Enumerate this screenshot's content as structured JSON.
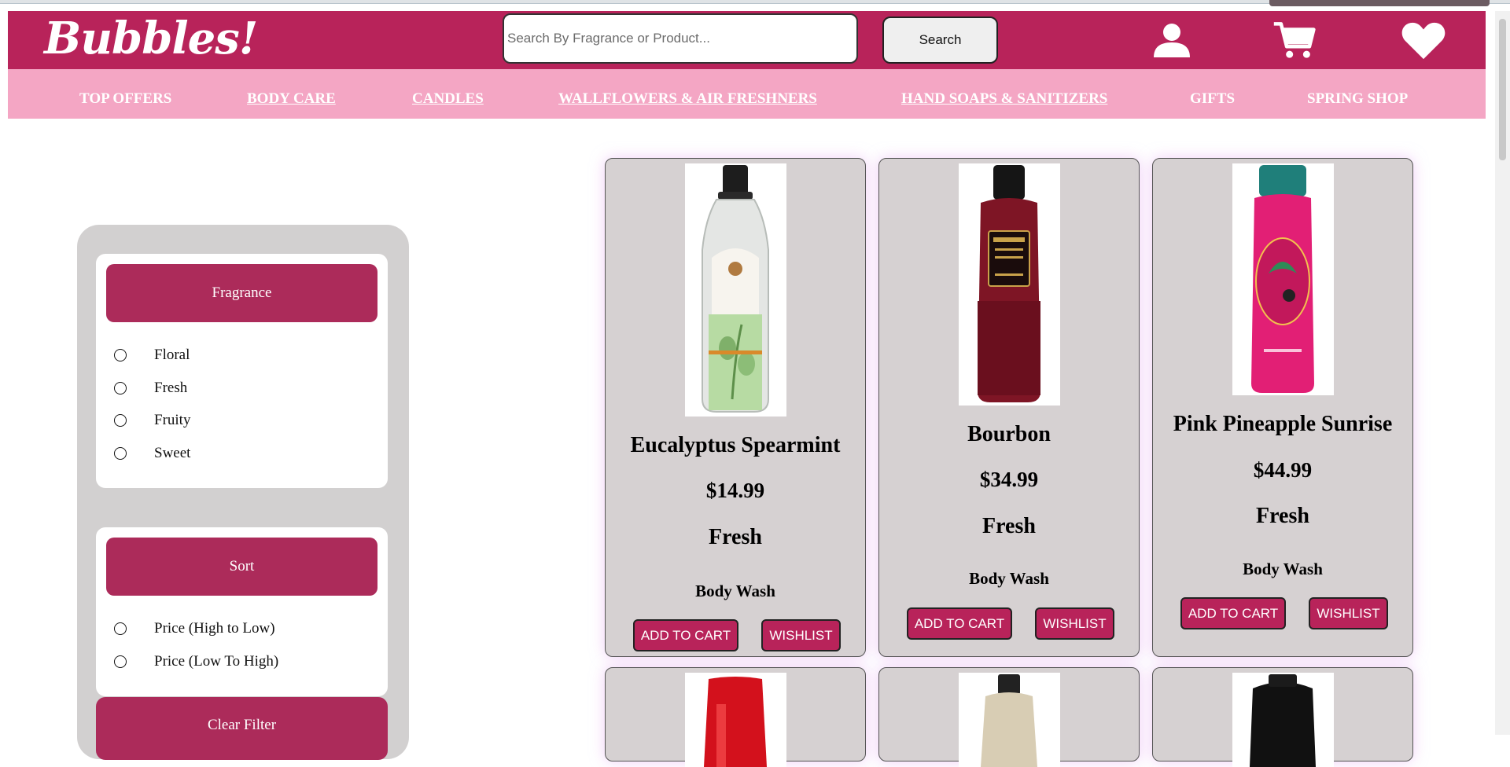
{
  "header": {
    "logo": "Bubbles!",
    "search": {
      "placeholder": "Search By Fragrance or Product...",
      "value": ""
    },
    "search_button": "Search",
    "icons": [
      "user-icon",
      "cart-icon",
      "heart-icon"
    ]
  },
  "nav": {
    "items": [
      {
        "label": "TOP OFFERS"
      },
      {
        "label": "BODY CARE"
      },
      {
        "label": "CANDLES"
      },
      {
        "label": "WALLFLOWERS & AIR FRESHNERS"
      },
      {
        "label": "HAND SOAPS & SANITIZERS"
      },
      {
        "label": "GIFTS"
      },
      {
        "label": "SPRING SHOP"
      }
    ]
  },
  "filters": {
    "fragrance": {
      "title": "Fragrance",
      "options": [
        {
          "label": "Floral"
        },
        {
          "label": "Fresh"
        },
        {
          "label": "Fruity"
        },
        {
          "label": "Sweet"
        }
      ]
    },
    "sort": {
      "title": "Sort",
      "options": [
        {
          "label": "Price (High to Low)"
        },
        {
          "label": "Price (Low To High)"
        }
      ]
    },
    "clear_label": "Clear Filter"
  },
  "products": [
    {
      "name": "Eucalyptus Spearmint",
      "price": "$14.99",
      "fragrance": "Fresh",
      "type": "Body Wash",
      "add_label": "ADD TO CART",
      "wish_label": "WISHLIST"
    },
    {
      "name": "Bourbon",
      "price": "$34.99",
      "fragrance": "Fresh",
      "type": "Body Wash",
      "add_label": "ADD TO CART",
      "wish_label": "WISHLIST"
    },
    {
      "name": "Pink Pineapple Sunrise",
      "price": "$44.99",
      "fragrance": "Fresh",
      "type": "Body Wash",
      "add_label": "ADD TO CART",
      "wish_label": "WISHLIST"
    }
  ],
  "colors": {
    "header": "#b8235a",
    "nav": "#f4a6c4",
    "button": "#ac2b5a",
    "card": "#d6d1d2"
  }
}
